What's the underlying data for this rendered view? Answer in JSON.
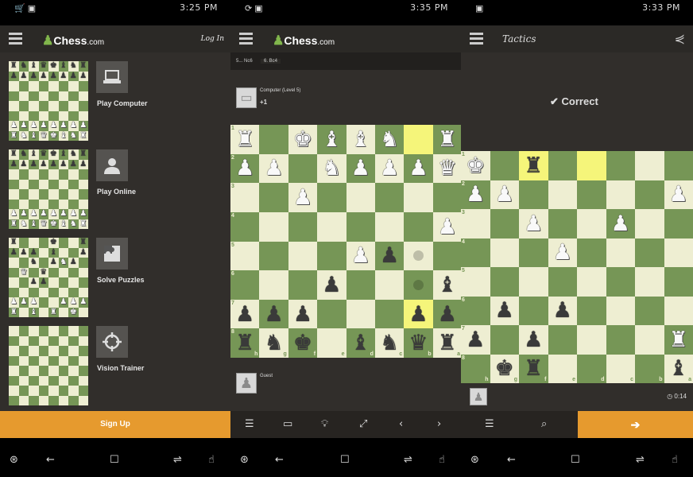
{
  "colors": {
    "light": "#eeeed2",
    "dark": "#769656",
    "highlight": "#f5f57a",
    "accent": "#e69a2e"
  },
  "panels": [
    {
      "status_time": "3:25 PM",
      "logo": "Chess",
      "logo_suffix": ".com",
      "login": "Log In",
      "menu": [
        {
          "label": "Play Computer",
          "icon": "laptop-icon",
          "board": [
            "rnbqkbnr",
            "pppppppp",
            "........",
            "........",
            "........",
            "........",
            "PPPPPPPP",
            "RNBQKBNR"
          ]
        },
        {
          "label": "Play Online",
          "icon": "person-icon",
          "board": [
            "rnbqkbnr",
            "pppppppp",
            "........",
            "........",
            "........",
            "........",
            "PPPPPPPP",
            "RNBQKBNR"
          ]
        },
        {
          "label": "Solve Puzzles",
          "icon": "puzzle-icon",
          "board": [
            "r...k..r",
            "ppp.b..p",
            "..n.pNp.",
            ".Q.q....",
            "..pp....",
            "........",
            "PPP..PPP",
            "R.B.R.K."
          ]
        },
        {
          "label": "Vision Trainer",
          "icon": "crosshair-icon",
          "board": [
            "........",
            "........",
            "........",
            "........",
            "........",
            "........",
            "........",
            "........"
          ]
        }
      ],
      "signup": "Sign Up"
    },
    {
      "status_time": "3:35 PM",
      "logo": "Chess",
      "logo_suffix": ".com",
      "moves": [
        "5... Nc6",
        "6. Bc4"
      ],
      "opponent": {
        "name": "Computer (Level 5)",
        "score": "+1"
      },
      "player": {
        "name": "Guest"
      },
      "board": {
        "rows": [
          "R.KBBN.R",
          "PP.NPPPQ",
          "..P.....",
          ".......P",
          "....Pp..",
          "...p...b",
          "ppp...pp",
          "rnk.bnqr"
        ],
        "highlights": [
          [
            0,
            6
          ],
          [
            6,
            6
          ]
        ],
        "hints": [
          [
            4,
            6
          ],
          [
            5,
            6
          ]
        ],
        "ranks": [
          "1",
          "2",
          "3",
          "4",
          "5",
          "6",
          "7",
          "8"
        ],
        "files": [
          "h",
          "g",
          "f",
          "e",
          "d",
          "c",
          "b",
          "a"
        ]
      },
      "toolbar": [
        "list-icon",
        "computer-icon",
        "hint-bulb-icon",
        "flip-board-icon",
        "back-arrow-icon",
        "forward-arrow-icon"
      ]
    },
    {
      "status_time": "3:33 PM",
      "title": "Tactics",
      "result": "Correct",
      "board": {
        "rows": [
          "K.r.....",
          "PP.....P",
          "..P..P..",
          "...P....",
          "........",
          ".p.p....",
          "p.p....R",
          ".kr....b"
        ],
        "highlights": [
          [
            0,
            2
          ],
          [
            0,
            4
          ]
        ],
        "hints": [],
        "ranks": [
          "1",
          "2",
          "3",
          "4",
          "5",
          "6",
          "7",
          "8"
        ],
        "files": [
          "h",
          "g",
          "f",
          "e",
          "d",
          "c",
          "b",
          "a"
        ]
      },
      "clock": "0:14"
    }
  ]
}
